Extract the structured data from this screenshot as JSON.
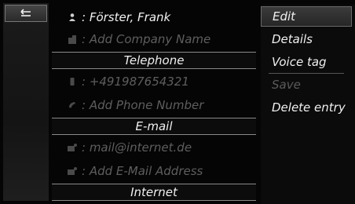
{
  "contact": {
    "name": ": Förster, Frank",
    "company": ": Add Company Name",
    "section_telephone": "Telephone",
    "phone": ": +491987654321",
    "add_phone": ": Add Phone Number",
    "section_email": "E-mail",
    "email": ": mail@internet.de",
    "add_email": ": Add E-Mail Address",
    "section_internet": "Internet"
  },
  "menu": {
    "items": [
      {
        "label": "Edit",
        "state": "selected"
      },
      {
        "label": "Details",
        "state": "enabled"
      },
      {
        "label": "Voice tag",
        "state": "enabled"
      },
      {
        "label": "Save",
        "state": "disabled"
      },
      {
        "label": "Delete entry",
        "state": "enabled"
      }
    ]
  },
  "icons": {
    "back": "back-arrow-icon",
    "person": "person-icon",
    "company": "company-building-icon",
    "mobile": "mobile-phone-icon",
    "phone": "phone-handset-icon",
    "email": "email-icon"
  },
  "colors": {
    "text": "#f0f0f0",
    "dim_text": "#5e5e5e",
    "background": "#050505"
  }
}
